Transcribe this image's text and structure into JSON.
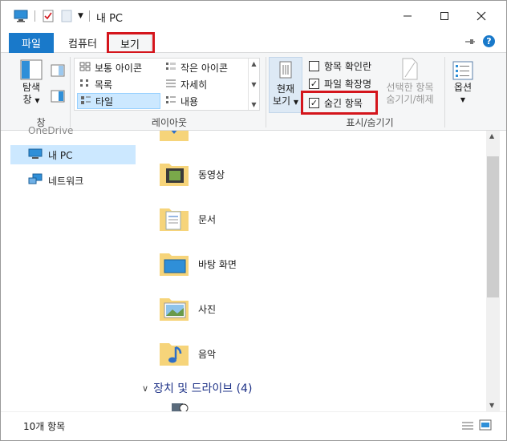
{
  "window": {
    "title": "내 PC"
  },
  "tabs": {
    "file": "파일",
    "computer": "컴퓨터",
    "view": "보기"
  },
  "ribbon": {
    "nav_pane": {
      "label_line1": "탐색",
      "label_line2": "창"
    },
    "pane_group_label": "창",
    "layout": {
      "items": [
        "보통 아이콘",
        "작은 아이콘",
        "목록",
        "자세히",
        "타일",
        "내용"
      ],
      "selected": "타일",
      "group_label": "레이아웃"
    },
    "current_view": {
      "label_line1": "현재",
      "label_line2": "보기"
    },
    "show_hide": {
      "item_checkboxes": {
        "label": "항목 확인란",
        "checked": false
      },
      "file_extensions": {
        "label": "파일 확장명",
        "checked": true
      },
      "hidden_items": {
        "label": "숨긴 항목",
        "checked": true
      },
      "hide_selected_line1": "선택한 항목",
      "hide_selected_line2": "숨기기/해제",
      "group_label": "표시/숨기기"
    },
    "options": {
      "label": "옵션"
    }
  },
  "nav": {
    "cut_item": "OneDrive",
    "this_pc": "내 PC",
    "network": "네트워크"
  },
  "content": {
    "folders": [
      {
        "name": "동영상",
        "icon": "videos-folder-icon"
      },
      {
        "name": "문서",
        "icon": "documents-folder-icon"
      },
      {
        "name": "바탕 화면",
        "icon": "desktop-folder-icon"
      },
      {
        "name": "사진",
        "icon": "pictures-folder-icon"
      },
      {
        "name": "음악",
        "icon": "music-folder-icon"
      }
    ],
    "devices_header": "장치 및 드라이브 (4)"
  },
  "status": {
    "item_count": "10개 항목"
  },
  "colors": {
    "file_tab": "#1979ca",
    "highlight_box": "#d4151c",
    "selection": "#cce8ff",
    "group_header": "#1e3287"
  }
}
